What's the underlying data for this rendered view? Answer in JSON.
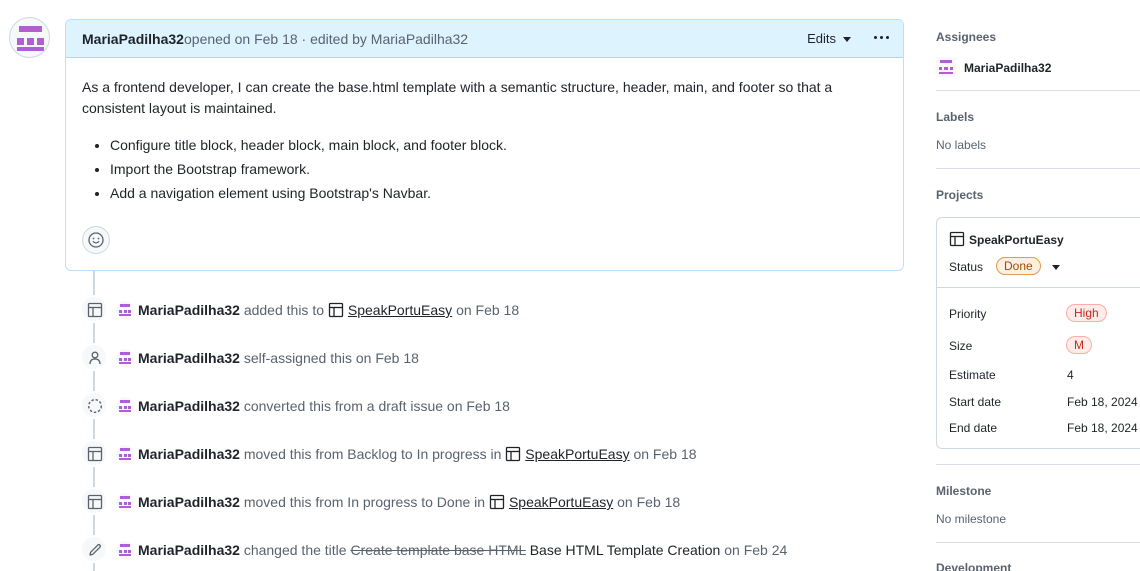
{
  "comment": {
    "author": "MariaPadilha32",
    "meta": "opened on Feb 18 · edited by MariaPadilha32",
    "edits_label": "Edits",
    "body_paragraph": "As a frontend developer, I can create the base.html template with a semantic structure, header, main, and footer so that a consistent layout is maintained.",
    "bullets": [
      "Configure title block, header block, main block, and footer block.",
      "Import the Bootstrap framework.",
      "Add a navigation element using Bootstrap's Navbar."
    ]
  },
  "timeline": [
    {
      "icon": "table-icon",
      "actor": "MariaPadilha32",
      "pre": "added this to",
      "project": "SpeakPortuEasy",
      "post": "on Feb 18"
    },
    {
      "icon": "person-icon",
      "actor": "MariaPadilha32",
      "text": "self-assigned this on Feb 18"
    },
    {
      "icon": "draft-circle-icon",
      "actor": "MariaPadilha32",
      "text": "converted this from a draft issue on Feb 18"
    },
    {
      "icon": "table-icon",
      "actor": "MariaPadilha32",
      "pre": "moved this from Backlog to In progress in",
      "project": "SpeakPortuEasy",
      "post": "on Feb 18"
    },
    {
      "icon": "table-icon",
      "actor": "MariaPadilha32",
      "pre": "moved this from In progress to Done in",
      "project": "SpeakPortuEasy",
      "post": "on Feb 18"
    },
    {
      "icon": "pencil-icon",
      "actor": "MariaPadilha32",
      "pre": "changed the title",
      "old_title": "Create template base HTML",
      "new_title": "Base HTML Template Creation",
      "post": "on Feb 24"
    }
  ],
  "sidebar": {
    "assignees_heading": "Assignees",
    "assignee": "MariaPadilha32",
    "labels_heading": "Labels",
    "labels_value": "No labels",
    "projects_heading": "Projects",
    "project": {
      "name": "SpeakPortuEasy",
      "status_label": "Status",
      "status_value": "Done",
      "fields": [
        {
          "label": "Priority",
          "value": "High"
        },
        {
          "label": "Size",
          "value": "M"
        },
        {
          "label": "Estimate",
          "value": "4"
        },
        {
          "label": "Start date",
          "value": "Feb 18, 2024"
        },
        {
          "label": "End date",
          "value": "Feb 18, 2024"
        }
      ]
    },
    "milestone_heading": "Milestone",
    "milestone_value": "No milestone",
    "development_heading": "Development"
  },
  "colors": {
    "identicon": "#b25cd6",
    "header_bg": "#ddf4ff",
    "done_badge": "#fbefe1",
    "high_badge": "#ffebe9"
  }
}
